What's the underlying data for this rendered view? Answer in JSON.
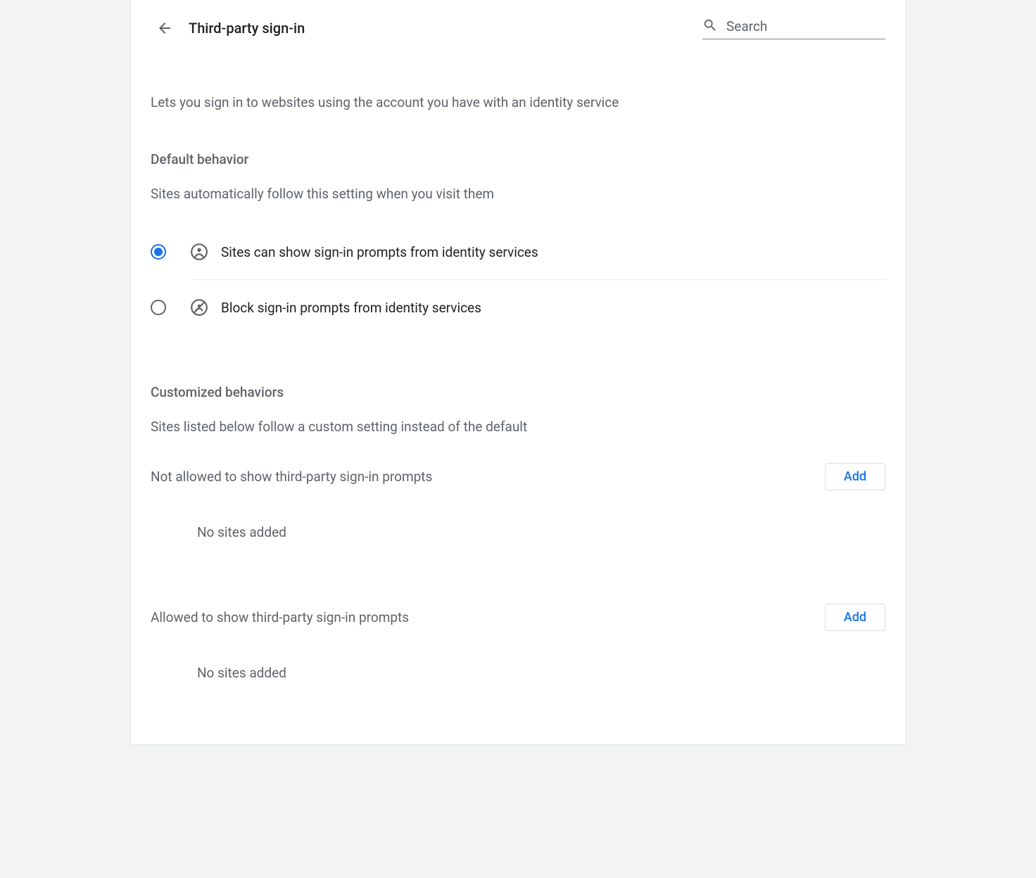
{
  "header": {
    "title": "Third-party sign-in",
    "search_placeholder": "Search"
  },
  "intro": "Lets you sign in to websites using the account you have with an identity service",
  "default_behavior": {
    "heading": "Default behavior",
    "subtext": "Sites automatically follow this setting when you visit them",
    "options": [
      {
        "label": "Sites can show sign-in prompts from identity services",
        "selected": true
      },
      {
        "label": "Block sign-in prompts from identity services",
        "selected": false
      }
    ]
  },
  "customized": {
    "heading": "Customized behaviors",
    "subtext": "Sites listed below follow a custom setting instead of the default",
    "not_allowed": {
      "title": "Not allowed to show third-party sign-in prompts",
      "add_label": "Add",
      "empty": "No sites added"
    },
    "allowed": {
      "title": "Allowed to show third-party sign-in prompts",
      "add_label": "Add",
      "empty": "No sites added"
    }
  }
}
